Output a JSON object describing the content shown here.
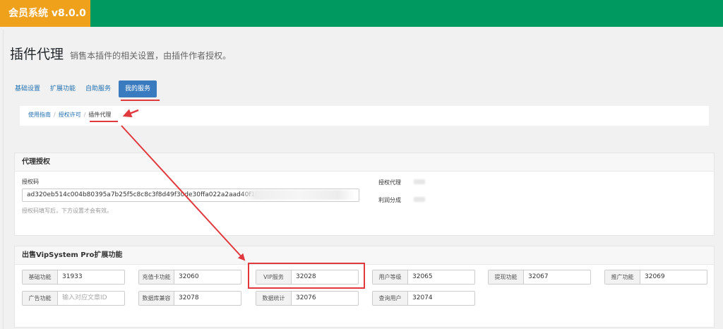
{
  "app": {
    "title": "会员系统 v8.0.0"
  },
  "page": {
    "title": "插件代理",
    "subtitle": "销售本插件的相关设置，由插件作者授权。"
  },
  "tabs": [
    {
      "label": "基础设置"
    },
    {
      "label": "扩展功能"
    },
    {
      "label": "自助服务"
    },
    {
      "label": "我的服务",
      "active": true
    }
  ],
  "breadcrumb": {
    "items": [
      "使用指南",
      "授权许可",
      "插件代理"
    ]
  },
  "auth_panel": {
    "title": "代理授权",
    "code_label": "授权码",
    "code_value": "ad320eb514c004b80395a7b25f5c8c8c3f8d49f30de30ffa022a2aad40f164",
    "code_hint": "授权码填写后，下方设置才会有效。",
    "agent_label": "授权代理",
    "share_label": "利润分成"
  },
  "sale_panel": {
    "title": "出售VipSystem Pro扩展功能",
    "fields": [
      {
        "label": "基础功能",
        "value": "31933"
      },
      {
        "label": "充值卡功能",
        "value": "32060"
      },
      {
        "label": "VIP服务",
        "value": "32028"
      },
      {
        "label": "用户等级",
        "value": "32065"
      },
      {
        "label": "提现功能",
        "value": "32067"
      },
      {
        "label": "推广功能",
        "value": "32069"
      },
      {
        "label": "广告功能",
        "value": "",
        "placeholder": "输入对应文章ID"
      },
      {
        "label": "数据库兼容",
        "value": "32078"
      },
      {
        "label": "数据统计",
        "value": "32076"
      },
      {
        "label": "查询用户",
        "value": "32074"
      }
    ]
  },
  "colors": {
    "topbar": "#009a61",
    "brand": "#f0a11c",
    "tab_active": "#3a7bbf",
    "annotation": "#e0393e"
  }
}
